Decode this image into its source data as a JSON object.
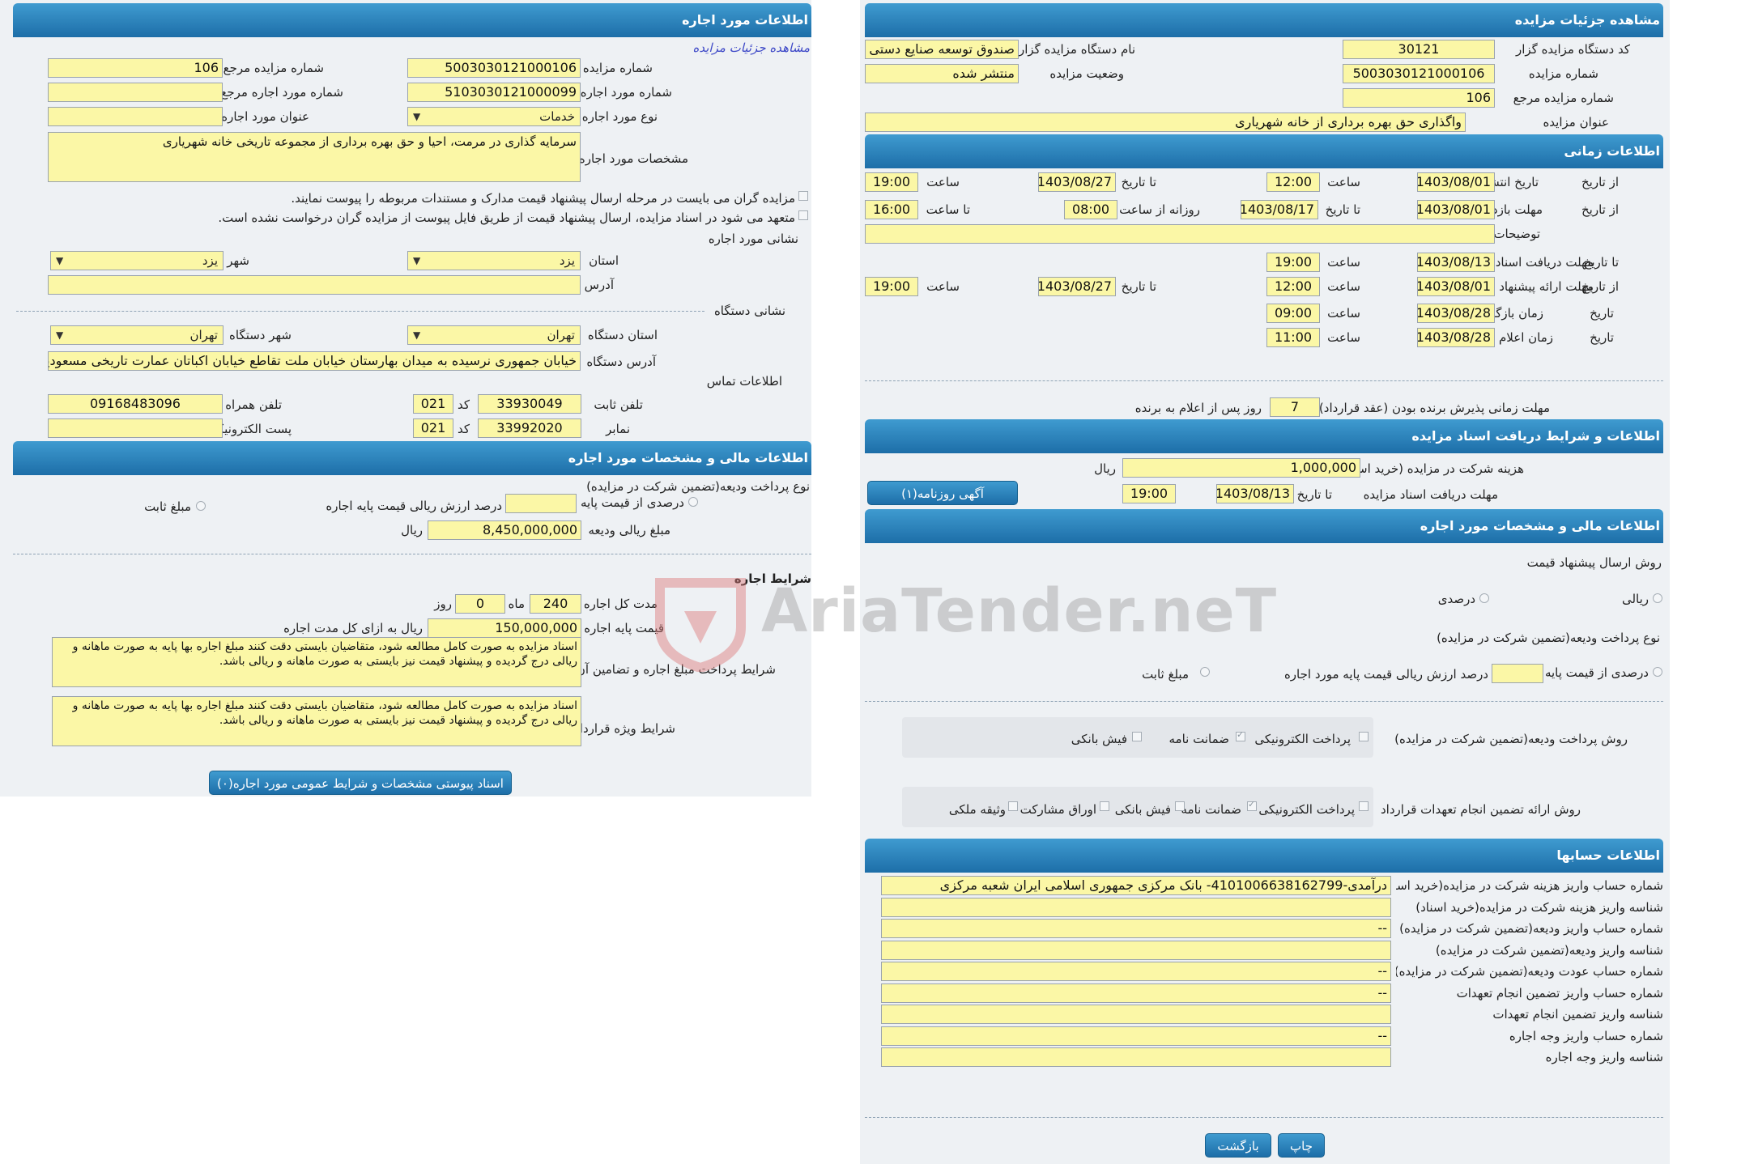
{
  "left": {
    "header": "مشاهده جزئیات مزایده",
    "code_label": "کد دستگاه مزایده گزار",
    "code": "30121",
    "org_label": "نام دستگاه مزایده گزار",
    "org": "صندوق توسعه صنایع دستی",
    "num_label": "شماره مزایده",
    "num": "5003030121000106",
    "status_label": "وضعیت مزایده",
    "status": "منتشر شده",
    "ref_label": "شماره مزایده مرجع",
    "ref": "106",
    "title_label": "عنوان مزایده",
    "title": "واگذاری  حق بهره برداری از خانه شهریاری",
    "time_header": "اطلاعات زمانی",
    "publish_label": "تاریخ انتشار",
    "from_date": "از تاریخ",
    "to_date": "تا تاریخ",
    "time_w": "ساعت",
    "to_time": "تا ساعت",
    "pub_from_d": "1403/08/01",
    "pub_from_t": "12:00",
    "pub_to_d": "1403/08/27",
    "pub_to_t": "19:00",
    "visit_label": "مهلت بازدید",
    "daily_from": "روزانه از ساعت",
    "visit_from_d": "1403/08/01",
    "visit_to_d": "1403/08/17",
    "visit_from_t": "08:00",
    "visit_to_t": "16:00",
    "desc_label": "توضیحات",
    "desc": "",
    "docs_label": "مهلت دریافت اسناد",
    "docs_to_d": "1403/08/13",
    "docs_to_t": "19:00",
    "offer_label": "مهلت ارائه پیشنهاد",
    "offer_from_d": "1403/08/01",
    "offer_from_t": "12:00",
    "offer_to_d": "1403/08/27",
    "offer_to_t": "19:00",
    "open_label": "زمان بازگشایی",
    "date_w": "تاریخ",
    "open_d": "1403/08/28",
    "open_t": "09:00",
    "winner_label": "زمان اعلام برنده",
    "winner_d": "1403/08/28",
    "winner_t": "11:00",
    "accept_label": "مهلت زمانی پذیرش برنده بودن (عقد قرارداد)",
    "accept_days": "7",
    "accept_suffix": "روز پس از اعلام به برنده",
    "docs_header": "اطلاعات و شرایط دریافت اسناد مزایده",
    "fee_label": "هزینه شرکت در مزایده (خرید اسناد)",
    "fee": "1,000,000",
    "rial": "ریال",
    "docs_deadline_label": "مهلت دریافت اسناد مزایده",
    "dd_d": "1403/08/13",
    "dd_t": "19:00",
    "ad_button": "آگهی روزنامه(۱)",
    "fin_header": "اطلاعات مالی و مشخصات مورد اجاره",
    "send_method": "روش ارسال پیشنهاد قیمت",
    "rial_opt": "ریالی",
    "percent_opt": "درصدی",
    "deposit_method": "نوع پرداخت ودیعه(تضمین شرکت در مزایده)",
    "pct_base": "درصدی از قیمت پایه",
    "pct_suffix": "درصد ارزش ریالی قیمت پایه مورد اجاره",
    "fixed_amt": "مبلغ ثابت",
    "pay_method": "روش پرداخت ودیعه(تضمین شرکت در مزایده)",
    "e_pay": "پرداخت الکترونیکی",
    "guarantee": "ضمانت نامه",
    "bank_slip": "فیش بانکی",
    "commit_method": "روش ارائه تضمین انجام تعهدات قرارداد",
    "bonds": "اوراق مشارکت",
    "property": "وثیقه ملکی",
    "acc_header": "اطلاعات حسابها",
    "accounts": [
      {
        "label": "شماره حساب واریز هزینه شرکت در مزایده(خرید اسناد)",
        "value": "درآمدی-4101006638162799- بانک مرکزی جمهوری اسلامی ایران شعبه مرکزی"
      },
      {
        "label": "شناسه واریز هزینه شرکت در مزایده(خرید اسناد)",
        "value": ""
      },
      {
        "label": "شماره حساب واریز ودیعه(تضمین شرکت در مزایده)",
        "value": "--"
      },
      {
        "label": "شناسه واریز ودیعه(تضمین شرکت در مزایده)",
        "value": ""
      },
      {
        "label": "شماره حساب عودت ودیعه(تضمین شرکت در مزایده)",
        "value": "--"
      },
      {
        "label": "شماره حساب واریز تضمین انجام تعهدات",
        "value": "--"
      },
      {
        "label": "شناسه واریز تضمین انجام تعهدات",
        "value": ""
      },
      {
        "label": "شماره حساب واریز وجه اجاره",
        "value": "--"
      },
      {
        "label": "شناسه واریز وجه اجاره",
        "value": ""
      }
    ],
    "print_btn": "چاپ",
    "back_btn": "بازگشت"
  },
  "right": {
    "header": "اطلاعات مورد اجاره",
    "link": "مشاهده جزئیات مزایده",
    "num_label": "شماره مزایده",
    "num": "5003030121000106",
    "ref_label": "شماره مزایده مرجع",
    "ref": "106",
    "lease_num_label": "شماره مورد اجاره",
    "lease_num": "5103030121000099",
    "lease_ref_label": "شماره مورد اجاره مرجع",
    "lease_ref": "",
    "type_label": "نوع مورد اجاره",
    "type": "خدمات",
    "lease_title_label": "عنوان مورد اجاره",
    "lease_title": "",
    "spec_label": "مشخصات مورد اجاره",
    "spec": "سرمایه گذاری در مرمت، احیا و حق بهره برداری از مجموعه تاریخی خانه شهریاری",
    "note1": "مزایده گران می بایست در مرحله ارسال پیشنهاد قیمت مدارک و مستندات مربوطه را پیوست نمایند.",
    "note2": "متعهد می شود در اسناد مزایده، ارسال پیشنهاد قیمت از طریق فایل پیوست از مزایده گران درخواست نشده است.",
    "addr_title": "نشانی مورد اجاره",
    "province_label": "استان",
    "province": "یزد",
    "city_label": "شهر",
    "city": "یزد",
    "address_label": "آدرس",
    "address": "",
    "org_addr_title": "نشانی دستگاه",
    "org_prov_label": "استان دستگاه",
    "org_prov": "تهران",
    "org_city_label": "شهر دستگاه",
    "org_city": "تهران",
    "org_addr_label": "آدرس دستگاه",
    "org_addr": "خیابان جمهوری نرسیده به میدان بهارستان خیابان ملت تقاطع خیابان اکباتان عمارت تاریخی مسعودیه",
    "contact_title": "اطلاعات تماس",
    "phone_label": "تلفن ثابت",
    "phone": "33930049",
    "code_w": "کد",
    "phone_code": "021",
    "mobile_label": "تلفن همراه",
    "mobile": "09168483096",
    "fax_label": "نمابر",
    "fax": "33992020",
    "fax_code": "021",
    "email_label": "پست الکترونیکی",
    "email": "",
    "fin_header": "اطلاعات مالی و مشخصات مورد اجاره",
    "deposit_type": "نوع پرداخت ودیعه(تضمین شرکت در مزایده)",
    "pct_base": "درصدی از قیمت پایه",
    "pct_suffix": "درصد ارزش ریالی قیمت پایه اجاره",
    "fixed_amt": "مبلغ ثابت",
    "deposit_amt_label": "مبلغ ریالی ودیعه",
    "deposit_amt": "8,450,000,000",
    "rial": "ریال",
    "lease_terms": "شرایط اجاره",
    "duration_label": "مدت کل اجاره",
    "months": "240",
    "month_w": "ماه",
    "days": "0",
    "day_w": "روز",
    "base_label": "قیمت پایه اجاره",
    "base_price": "150,000,000",
    "base_suffix": "ریال به ازای کل مدت اجاره",
    "pay_terms_label": "شرایط پرداخت مبلغ اجاره و تضامین آن",
    "pay_terms": "اسناد مزایده به صورت کامل مطالعه شود، متقاضیان بایستی دقت کنند مبلغ اجاره بها پایه به صورت ماهانه و ریالی درج گردیده و پیشنهاد قیمت نیز بایستی به صورت ماهانه و ریالی باشد.",
    "special_label": "شرایط ویژه قرارداد",
    "special": "اسناد مزایده به صورت کامل مطالعه شود، متقاضیان بایستی دقت کنند مبلغ اجاره بها پایه به صورت ماهانه و ریالی درج گردیده و پیشنهاد قیمت نیز بایستی به صورت ماهانه و ریالی باشد.",
    "attach_btn": "اسناد پیوستی مشخصات و شرایط عمومی مورد اجاره(۰)"
  },
  "watermark": "AriaTender.neT"
}
